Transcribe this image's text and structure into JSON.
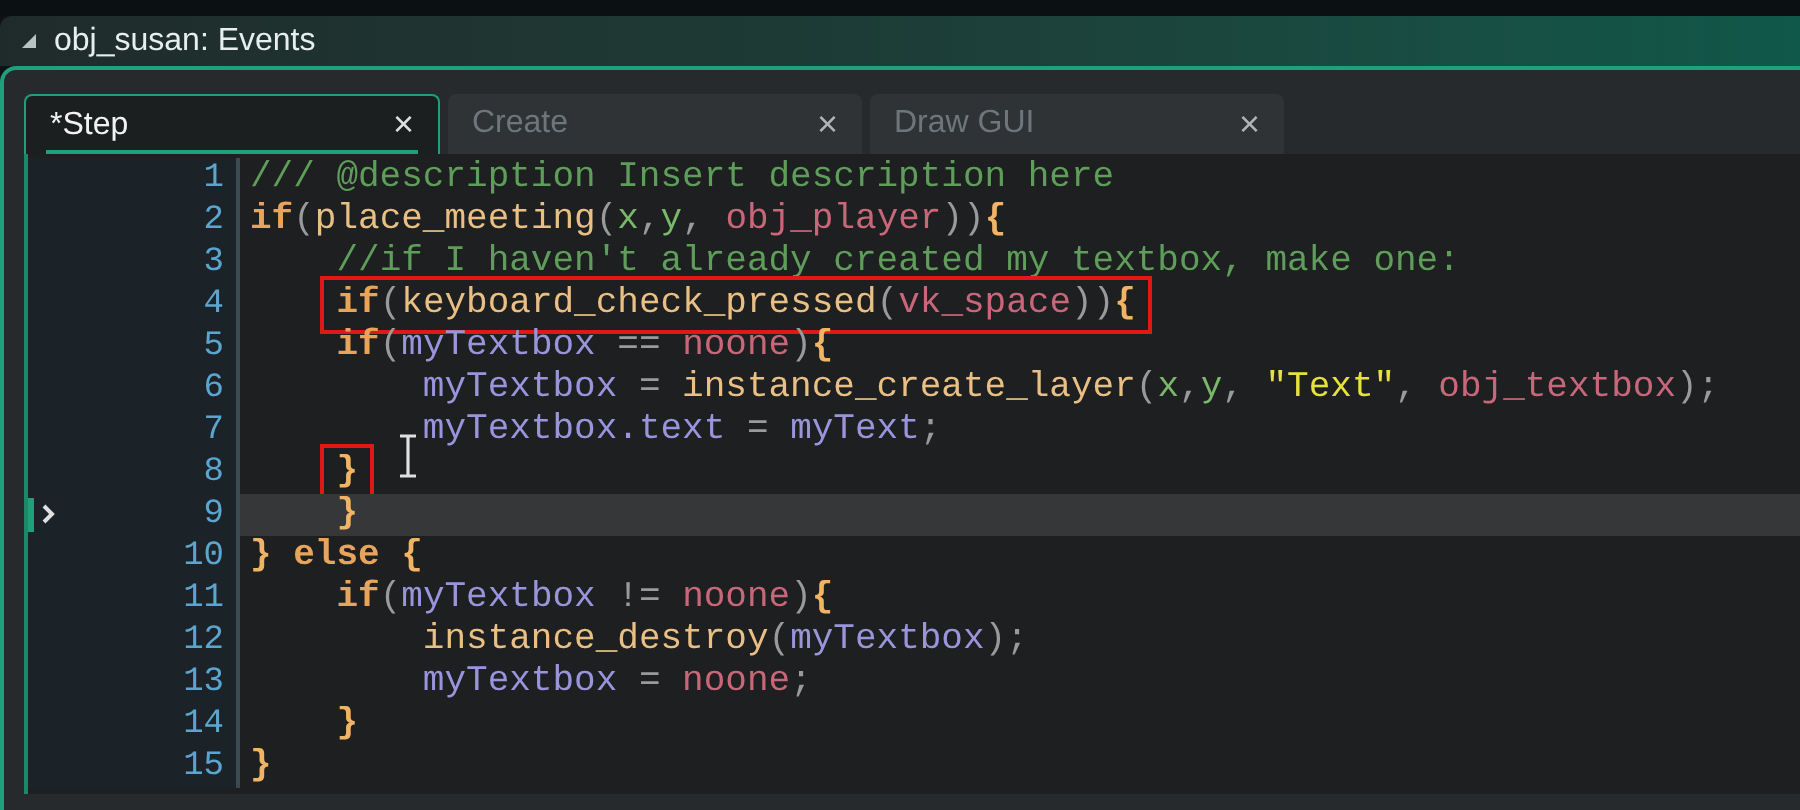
{
  "window": {
    "title": "obj_susan: Events"
  },
  "tabs": [
    {
      "label": "*Step",
      "selected": true,
      "close": "×"
    },
    {
      "label": "Create",
      "selected": false,
      "close": "×"
    },
    {
      "label": "Draw GUI",
      "selected": false,
      "close": "×"
    }
  ],
  "editor": {
    "lines": [
      {
        "number": "1",
        "current": false,
        "boxed": false,
        "tokens": [
          {
            "kind": "comment",
            "text": "/// @description Insert description here"
          }
        ]
      },
      {
        "number": "2",
        "current": false,
        "boxed": false,
        "tokens": [
          {
            "kind": "keyword",
            "text": "if"
          },
          {
            "kind": "punct",
            "text": "("
          },
          {
            "kind": "function",
            "text": "place_meeting"
          },
          {
            "kind": "punct",
            "text": "("
          },
          {
            "kind": "builtin",
            "text": "x"
          },
          {
            "kind": "punct",
            "text": ","
          },
          {
            "kind": "builtin",
            "text": "y"
          },
          {
            "kind": "punct",
            "text": ", "
          },
          {
            "kind": "constant",
            "text": "obj_player"
          },
          {
            "kind": "punct",
            "text": "))"
          },
          {
            "kind": "brace",
            "text": "{"
          }
        ]
      },
      {
        "number": "3",
        "current": false,
        "boxed": false,
        "tokens": [
          {
            "kind": "comment",
            "text": "    //if I haven't already created my textbox, make one:"
          }
        ]
      },
      {
        "number": "4",
        "current": false,
        "boxed": true,
        "tokens": [
          {
            "kind": "keyword",
            "text": "    if"
          },
          {
            "kind": "punct",
            "text": "("
          },
          {
            "kind": "function",
            "text": "keyboard_check_pressed"
          },
          {
            "kind": "punct",
            "text": "("
          },
          {
            "kind": "constant",
            "text": "vk_space"
          },
          {
            "kind": "punct",
            "text": "))"
          },
          {
            "kind": "brace",
            "text": "{"
          }
        ]
      },
      {
        "number": "5",
        "current": false,
        "boxed": false,
        "tokens": [
          {
            "kind": "keyword",
            "text": "    if"
          },
          {
            "kind": "punct",
            "text": "("
          },
          {
            "kind": "variable",
            "text": "myTextbox"
          },
          {
            "kind": "punct",
            "text": " == "
          },
          {
            "kind": "constant",
            "text": "noone"
          },
          {
            "kind": "punct",
            "text": ")"
          },
          {
            "kind": "brace",
            "text": "{"
          }
        ]
      },
      {
        "number": "6",
        "current": false,
        "boxed": false,
        "tokens": [
          {
            "kind": "variable",
            "text": "        myTextbox"
          },
          {
            "kind": "punct",
            "text": " = "
          },
          {
            "kind": "function",
            "text": "instance_create_layer"
          },
          {
            "kind": "punct",
            "text": "("
          },
          {
            "kind": "builtin",
            "text": "x"
          },
          {
            "kind": "punct",
            "text": ","
          },
          {
            "kind": "builtin",
            "text": "y"
          },
          {
            "kind": "punct",
            "text": ", "
          },
          {
            "kind": "string",
            "text": "\"Text\""
          },
          {
            "kind": "punct",
            "text": ", "
          },
          {
            "kind": "constant",
            "text": "obj_textbox"
          },
          {
            "kind": "punct",
            "text": ");"
          }
        ]
      },
      {
        "number": "7",
        "current": false,
        "boxed": false,
        "tokens": [
          {
            "kind": "variable",
            "text": "        myTextbox.text"
          },
          {
            "kind": "punct",
            "text": " = "
          },
          {
            "kind": "variable",
            "text": "myText"
          },
          {
            "kind": "punct",
            "text": ";"
          }
        ]
      },
      {
        "number": "8",
        "current": false,
        "boxed": true,
        "tokens": [
          {
            "kind": "brace",
            "text": "    }"
          }
        ]
      },
      {
        "number": "9",
        "current": true,
        "boxed": false,
        "tokens": [
          {
            "kind": "brace",
            "text": "    }"
          }
        ]
      },
      {
        "number": "10",
        "current": false,
        "boxed": false,
        "tokens": [
          {
            "kind": "brace",
            "text": "}"
          },
          {
            "kind": "keyword",
            "text": " else"
          },
          {
            "kind": "brace",
            "text": " {"
          }
        ]
      },
      {
        "number": "11",
        "current": false,
        "boxed": false,
        "tokens": [
          {
            "kind": "keyword",
            "text": "    if"
          },
          {
            "kind": "punct",
            "text": "("
          },
          {
            "kind": "variable",
            "text": "myTextbox"
          },
          {
            "kind": "punct",
            "text": " != "
          },
          {
            "kind": "constant",
            "text": "noone"
          },
          {
            "kind": "punct",
            "text": ")"
          },
          {
            "kind": "brace",
            "text": "{"
          }
        ]
      },
      {
        "number": "12",
        "current": false,
        "boxed": false,
        "tokens": [
          {
            "kind": "function",
            "text": "        instance_destroy"
          },
          {
            "kind": "punct",
            "text": "("
          },
          {
            "kind": "variable",
            "text": "myTextbox"
          },
          {
            "kind": "punct",
            "text": ");"
          }
        ]
      },
      {
        "number": "13",
        "current": false,
        "boxed": false,
        "tokens": [
          {
            "kind": "variable",
            "text": "        myTextbox"
          },
          {
            "kind": "punct",
            "text": " = "
          },
          {
            "kind": "constant",
            "text": "noone"
          },
          {
            "kind": "punct",
            "text": ";"
          }
        ]
      },
      {
        "number": "14",
        "current": false,
        "boxed": false,
        "tokens": [
          {
            "kind": "brace",
            "text": "    }"
          }
        ]
      },
      {
        "number": "15",
        "current": false,
        "boxed": false,
        "tokens": [
          {
            "kind": "brace",
            "text": "}"
          }
        ]
      }
    ]
  }
}
